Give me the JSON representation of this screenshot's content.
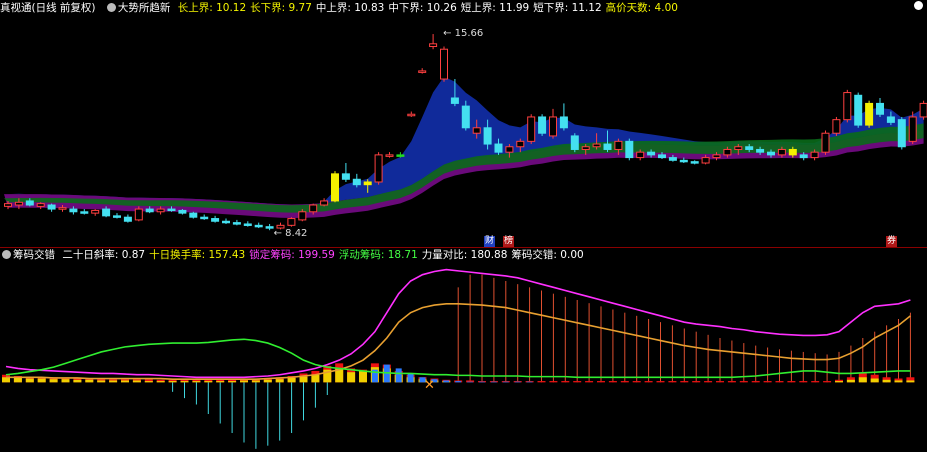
{
  "upper": {
    "stock_name": "真视通",
    "mode": "(日线 前复权)",
    "indicator": "大势所趋新",
    "stats": [
      {
        "label": "长上界:",
        "value": "10.12",
        "color": "#f5f500"
      },
      {
        "label": "长下界:",
        "value": "9.77",
        "color": "#f5f500"
      },
      {
        "label": "中上界:",
        "value": "10.83",
        "color": "#ffffff"
      },
      {
        "label": "中下界:",
        "value": "10.26",
        "color": "#ffffff"
      },
      {
        "label": "短上界:",
        "value": "11.99",
        "color": "#ffffff"
      },
      {
        "label": "短下界:",
        "value": "11.12",
        "color": "#ffffff"
      },
      {
        "label": "高价天数:",
        "value": "4.00",
        "color": "#f5f500"
      }
    ],
    "high_label": "15.66",
    "low_label": "8.42",
    "tags": [
      {
        "text": "财",
        "color": "#3355ff"
      },
      {
        "text": "榜",
        "color": "#cc2222"
      },
      {
        "text": "券",
        "color": "#cc2222"
      }
    ]
  },
  "lower": {
    "indicator": "筹码交错",
    "stats": [
      {
        "label": "二十日斜率:",
        "value": "0.87",
        "color": "#ffffff"
      },
      {
        "label": "十日换手率:",
        "value": "157.43",
        "color": "#f5f500"
      },
      {
        "label": "锁定筹码:",
        "value": "199.59",
        "color": "#ff44ff"
      },
      {
        "label": "浮动筹码:",
        "value": "18.71",
        "color": "#44ff44"
      },
      {
        "label": "力量对比:",
        "value": "180.88",
        "color": "#ffffff"
      },
      {
        "label": "筹码交错:",
        "value": "0.00",
        "color": "#ffffff"
      }
    ]
  },
  "colors": {
    "up": "#ff4040",
    "down": "#44e0f0",
    "up_fill": "#000000",
    "band_blue": "#102a9a",
    "band_purple": "#6a0a7a",
    "band_green": "#0a6a1a",
    "yellow": "#f5f000",
    "green_bar": "#22dd22"
  },
  "chart_data": [
    {
      "type": "candlestick",
      "ylim": [
        7.8,
        16.4
      ],
      "candles": [
        {
          "o": 9.3,
          "h": 9.5,
          "l": 9.2,
          "c": 9.4
        },
        {
          "o": 9.35,
          "h": 9.6,
          "l": 9.2,
          "c": 9.45
        },
        {
          "o": 9.5,
          "h": 9.6,
          "l": 9.3,
          "c": 9.35
        },
        {
          "o": 9.3,
          "h": 9.45,
          "l": 9.2,
          "c": 9.4
        },
        {
          "o": 9.35,
          "h": 9.4,
          "l": 9.1,
          "c": 9.2
        },
        {
          "o": 9.2,
          "h": 9.35,
          "l": 9.1,
          "c": 9.25
        },
        {
          "o": 9.2,
          "h": 9.3,
          "l": 9.0,
          "c": 9.1
        },
        {
          "o": 9.1,
          "h": 9.2,
          "l": 9.0,
          "c": 9.05
        },
        {
          "o": 9.05,
          "h": 9.2,
          "l": 8.95,
          "c": 9.15
        },
        {
          "o": 9.2,
          "h": 9.3,
          "l": 8.9,
          "c": 8.95
        },
        {
          "o": 8.95,
          "h": 9.05,
          "l": 8.85,
          "c": 8.9
        },
        {
          "o": 8.9,
          "h": 9.0,
          "l": 8.7,
          "c": 8.75
        },
        {
          "o": 8.8,
          "h": 9.3,
          "l": 8.75,
          "c": 9.2
        },
        {
          "o": 9.2,
          "h": 9.3,
          "l": 9.05,
          "c": 9.1
        },
        {
          "o": 9.1,
          "h": 9.3,
          "l": 9.0,
          "c": 9.2
        },
        {
          "o": 9.2,
          "h": 9.3,
          "l": 9.1,
          "c": 9.15
        },
        {
          "o": 9.15,
          "h": 9.2,
          "l": 9.0,
          "c": 9.05
        },
        {
          "o": 9.05,
          "h": 9.1,
          "l": 8.85,
          "c": 8.9
        },
        {
          "o": 8.9,
          "h": 9.0,
          "l": 8.8,
          "c": 8.85
        },
        {
          "o": 8.85,
          "h": 8.95,
          "l": 8.7,
          "c": 8.75
        },
        {
          "o": 8.75,
          "h": 8.85,
          "l": 8.65,
          "c": 8.7
        },
        {
          "o": 8.7,
          "h": 8.8,
          "l": 8.6,
          "c": 8.65
        },
        {
          "o": 8.65,
          "h": 8.75,
          "l": 8.55,
          "c": 8.6
        },
        {
          "o": 8.6,
          "h": 8.7,
          "l": 8.5,
          "c": 8.55
        },
        {
          "o": 8.55,
          "h": 8.65,
          "l": 8.42,
          "c": 8.5
        },
        {
          "o": 8.5,
          "h": 8.7,
          "l": 8.45,
          "c": 8.6
        },
        {
          "o": 8.6,
          "h": 8.9,
          "l": 8.55,
          "c": 8.85
        },
        {
          "o": 8.8,
          "h": 9.2,
          "l": 8.75,
          "c": 9.1
        },
        {
          "o": 9.1,
          "h": 9.4,
          "l": 9.0,
          "c": 9.35
        },
        {
          "o": 9.35,
          "h": 9.6,
          "l": 9.3,
          "c": 9.5
        },
        {
          "o": 9.5,
          "h": 10.6,
          "l": 9.45,
          "c": 10.5
        },
        {
          "o": 10.5,
          "h": 10.9,
          "l": 10.2,
          "c": 10.3
        },
        {
          "o": 10.3,
          "h": 10.5,
          "l": 10.0,
          "c": 10.1
        },
        {
          "o": 10.1,
          "h": 10.3,
          "l": 9.8,
          "c": 10.2
        },
        {
          "o": 10.2,
          "h": 11.3,
          "l": 10.1,
          "c": 11.2
        },
        {
          "o": 11.2,
          "h": 11.3,
          "l": 11.1,
          "c": 11.2
        },
        {
          "o": 11.2,
          "h": 11.3,
          "l": 11.1,
          "c": 11.2
        },
        {
          "o": 12.7,
          "h": 12.8,
          "l": 12.6,
          "c": 12.7
        },
        {
          "o": 14.3,
          "h": 14.4,
          "l": 14.2,
          "c": 14.3
        },
        {
          "o": 15.2,
          "h": 15.66,
          "l": 15.1,
          "c": 15.3
        },
        {
          "o": 14.0,
          "h": 15.2,
          "l": 13.9,
          "c": 15.1
        },
        {
          "o": 13.3,
          "h": 14.0,
          "l": 13.0,
          "c": 13.1
        },
        {
          "o": 13.0,
          "h": 13.2,
          "l": 12.1,
          "c": 12.2
        },
        {
          "o": 12.0,
          "h": 12.5,
          "l": 11.8,
          "c": 12.2
        },
        {
          "o": 12.2,
          "h": 12.5,
          "l": 11.4,
          "c": 11.6
        },
        {
          "o": 11.6,
          "h": 11.8,
          "l": 11.2,
          "c": 11.3
        },
        {
          "o": 11.3,
          "h": 11.6,
          "l": 11.1,
          "c": 11.5
        },
        {
          "o": 11.5,
          "h": 11.8,
          "l": 11.3,
          "c": 11.7
        },
        {
          "o": 11.7,
          "h": 12.7,
          "l": 11.6,
          "c": 12.6
        },
        {
          "o": 12.6,
          "h": 12.7,
          "l": 11.9,
          "c": 12.0
        },
        {
          "o": 11.9,
          "h": 12.9,
          "l": 11.8,
          "c": 12.6
        },
        {
          "o": 12.6,
          "h": 13.1,
          "l": 12.1,
          "c": 12.2
        },
        {
          "o": 11.9,
          "h": 12.0,
          "l": 11.3,
          "c": 11.4
        },
        {
          "o": 11.4,
          "h": 11.6,
          "l": 11.2,
          "c": 11.5
        },
        {
          "o": 11.5,
          "h": 12.0,
          "l": 11.4,
          "c": 11.6
        },
        {
          "o": 11.6,
          "h": 12.1,
          "l": 11.3,
          "c": 11.4
        },
        {
          "o": 11.4,
          "h": 11.8,
          "l": 11.2,
          "c": 11.7
        },
        {
          "o": 11.7,
          "h": 11.8,
          "l": 11.0,
          "c": 11.1
        },
        {
          "o": 11.1,
          "h": 11.4,
          "l": 11.0,
          "c": 11.3
        },
        {
          "o": 11.3,
          "h": 11.4,
          "l": 11.1,
          "c": 11.2
        },
        {
          "o": 11.2,
          "h": 11.3,
          "l": 11.05,
          "c": 11.1
        },
        {
          "o": 11.1,
          "h": 11.2,
          "l": 10.95,
          "c": 11.0
        },
        {
          "o": 11.0,
          "h": 11.1,
          "l": 10.9,
          "c": 10.95
        },
        {
          "o": 10.95,
          "h": 11.0,
          "l": 10.85,
          "c": 10.9
        },
        {
          "o": 10.9,
          "h": 11.2,
          "l": 10.85,
          "c": 11.1
        },
        {
          "o": 11.1,
          "h": 11.3,
          "l": 11.0,
          "c": 11.2
        },
        {
          "o": 11.2,
          "h": 11.5,
          "l": 11.1,
          "c": 11.4
        },
        {
          "o": 11.4,
          "h": 11.6,
          "l": 11.2,
          "c": 11.5
        },
        {
          "o": 11.5,
          "h": 11.6,
          "l": 11.3,
          "c": 11.4
        },
        {
          "o": 11.4,
          "h": 11.5,
          "l": 11.2,
          "c": 11.3
        },
        {
          "o": 11.3,
          "h": 11.4,
          "l": 11.1,
          "c": 11.2
        },
        {
          "o": 11.2,
          "h": 11.5,
          "l": 11.1,
          "c": 11.4
        },
        {
          "o": 11.4,
          "h": 11.5,
          "l": 11.1,
          "c": 11.2
        },
        {
          "o": 11.2,
          "h": 11.3,
          "l": 11.0,
          "c": 11.1
        },
        {
          "o": 11.1,
          "h": 11.4,
          "l": 11.0,
          "c": 11.3
        },
        {
          "o": 11.3,
          "h": 12.1,
          "l": 11.2,
          "c": 12.0
        },
        {
          "o": 12.0,
          "h": 12.6,
          "l": 11.9,
          "c": 12.5
        },
        {
          "o": 12.5,
          "h": 13.6,
          "l": 12.4,
          "c": 13.5
        },
        {
          "o": 13.4,
          "h": 13.5,
          "l": 12.2,
          "c": 12.3
        },
        {
          "o": 12.3,
          "h": 13.2,
          "l": 12.2,
          "c": 13.1
        },
        {
          "o": 13.1,
          "h": 13.3,
          "l": 12.6,
          "c": 12.7
        },
        {
          "o": 12.6,
          "h": 12.8,
          "l": 12.3,
          "c": 12.4
        },
        {
          "o": 12.5,
          "h": 12.6,
          "l": 11.4,
          "c": 11.5
        },
        {
          "o": 11.7,
          "h": 12.8,
          "l": 11.6,
          "c": 12.6
        },
        {
          "o": 12.6,
          "h": 13.2,
          "l": 12.5,
          "c": 13.1
        }
      ],
      "yellow_bars": [
        30,
        33,
        72,
        79
      ],
      "green_bars": [
        36
      ]
    },
    {
      "type": "bar+line",
      "ylim": [
        -110,
        190
      ],
      "series": [
        {
          "key": "purple",
          "color": "#ff30ff",
          "values": [
            25,
            22,
            20,
            19,
            18,
            17,
            16,
            15,
            14,
            14,
            13,
            12,
            12,
            11,
            10,
            9,
            8,
            8,
            8,
            8,
            8,
            9,
            10,
            12,
            15,
            18,
            22,
            28,
            35,
            45,
            60,
            80,
            110,
            140,
            160,
            170,
            175,
            178,
            176,
            174,
            172,
            170,
            168,
            165,
            160,
            155,
            150,
            145,
            140,
            135,
            130,
            125,
            120,
            115,
            110,
            105,
            100,
            95,
            92,
            90,
            88,
            85,
            83,
            80,
            78,
            76,
            75,
            74,
            74,
            75,
            80,
            95,
            110,
            120,
            122,
            124,
            130
          ]
        },
        {
          "key": "orange",
          "color": "#e8a030",
          "values": [
            8,
            8,
            8,
            8,
            7,
            7,
            7,
            6,
            6,
            6,
            6,
            6,
            6,
            6,
            5,
            5,
            5,
            5,
            5,
            5,
            5,
            5,
            6,
            7,
            8,
            10,
            12,
            16,
            20,
            26,
            35,
            50,
            70,
            95,
            110,
            118,
            122,
            124,
            124,
            123,
            122,
            120,
            118,
            114,
            110,
            106,
            102,
            98,
            94,
            90,
            86,
            82,
            78,
            74,
            70,
            66,
            62,
            58,
            55,
            52,
            50,
            48,
            46,
            44,
            42,
            40,
            38,
            37,
            36,
            36,
            38,
            46,
            56,
            70,
            80,
            90,
            105
          ]
        },
        {
          "key": "green",
          "color": "#30ee30",
          "values": [
            12,
            14,
            17,
            20,
            24,
            30,
            36,
            42,
            48,
            52,
            56,
            58,
            60,
            61,
            62,
            62,
            62,
            63,
            65,
            67,
            68,
            66,
            62,
            55,
            46,
            35,
            28,
            24,
            22,
            20,
            18,
            16,
            15,
            14,
            14,
            13,
            12,
            12,
            11,
            11,
            10,
            10,
            10,
            10,
            9,
            9,
            9,
            9,
            8,
            8,
            8,
            8,
            8,
            8,
            8,
            8,
            8,
            8,
            8,
            8,
            8,
            8,
            9,
            10,
            12,
            14,
            16,
            18,
            18,
            16,
            14,
            14,
            15,
            16,
            17,
            18,
            18
          ]
        }
      ],
      "stems": [
        0,
        0,
        0,
        0,
        0,
        0,
        0,
        0,
        0,
        0,
        0,
        0,
        0,
        0,
        -15,
        -25,
        -35,
        -50,
        -65,
        -80,
        -95,
        -105,
        -100,
        -92,
        -80,
        -60,
        -40,
        -20,
        0,
        0,
        0,
        0,
        0,
        0,
        0,
        0,
        0,
        0,
        150,
        170,
        170,
        165,
        160,
        155,
        150,
        145,
        140,
        135,
        130,
        125,
        120,
        115,
        110,
        105,
        100,
        95,
        90,
        85,
        80,
        75,
        70,
        66,
        62,
        58,
        55,
        52,
        50,
        48,
        46,
        44,
        48,
        58,
        70,
        80,
        90,
        100,
        110
      ],
      "bars_red": [
        12,
        10,
        9,
        8,
        8,
        7,
        7,
        6,
        6,
        5,
        5,
        5,
        5,
        4,
        4,
        4,
        4,
        4,
        4,
        4,
        5,
        5,
        6,
        8,
        10,
        14,
        18,
        26,
        30,
        22,
        20,
        30,
        28,
        18,
        12,
        8,
        6,
        4,
        3,
        3,
        2,
        2,
        2,
        2,
        2,
        2,
        2,
        2,
        2,
        2,
        2,
        2,
        2,
        2,
        2,
        2,
        2,
        2,
        2,
        2,
        2,
        2,
        2,
        2,
        2,
        2,
        2,
        2,
        2,
        2,
        4,
        8,
        14,
        12,
        8,
        6,
        8
      ],
      "bars_yellow": [
        8,
        7,
        6,
        6,
        5,
        5,
        4,
        4,
        3,
        3,
        3,
        3,
        2,
        2,
        2,
        2,
        2,
        2,
        2,
        2,
        3,
        3,
        4,
        5,
        7,
        9,
        12,
        20,
        22,
        16,
        18,
        24,
        22,
        12,
        8,
        5,
        3,
        2,
        0,
        0,
        0,
        0,
        0,
        0,
        0,
        0,
        0,
        0,
        0,
        0,
        0,
        0,
        0,
        0,
        0,
        0,
        0,
        0,
        0,
        0,
        0,
        0,
        0,
        0,
        0,
        0,
        0,
        0,
        0,
        0,
        2,
        4,
        8,
        6,
        4,
        3,
        3
      ],
      "bars_blue": [
        0,
        0,
        0,
        0,
        0,
        0,
        0,
        0,
        0,
        0,
        0,
        0,
        0,
        0,
        0,
        0,
        0,
        0,
        0,
        0,
        0,
        0,
        0,
        0,
        0,
        0,
        0,
        0,
        0,
        0,
        0,
        20,
        28,
        22,
        14,
        8,
        5,
        3,
        2,
        1,
        1,
        1,
        1,
        1,
        1,
        0,
        0,
        0,
        0,
        0,
        0,
        0,
        0,
        0,
        0,
        0,
        0,
        0,
        0,
        0,
        0,
        0,
        0,
        0,
        0,
        0,
        0,
        0,
        0,
        0,
        0,
        0,
        0,
        0,
        0,
        0,
        0
      ]
    }
  ]
}
